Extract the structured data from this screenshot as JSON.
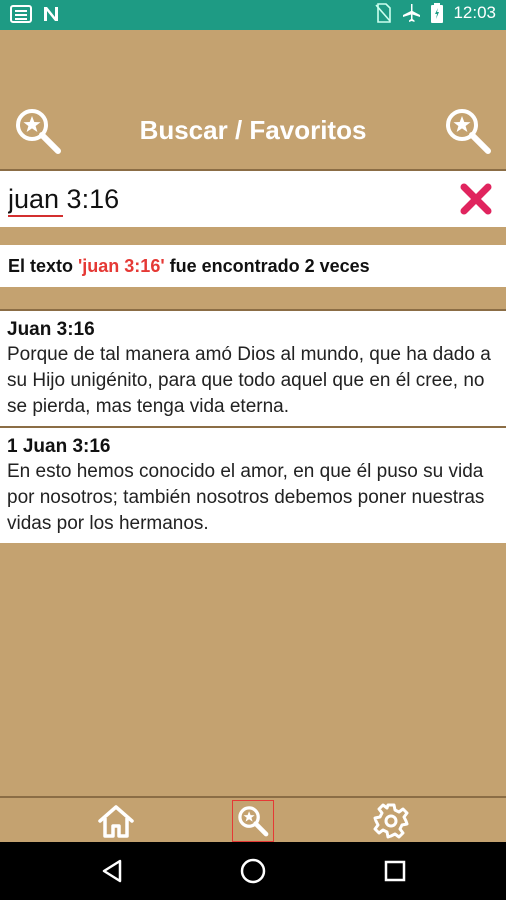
{
  "status_bar": {
    "time": "12:03"
  },
  "app_bar": {
    "title": "Buscar / Favoritos"
  },
  "search": {
    "value": "juan 3:16"
  },
  "result_banner": {
    "prefix": "El texto ",
    "query": "'juan 3:16'",
    "suffix": " fue encontrado 2 veces"
  },
  "results": [
    {
      "ref": "Juan 3:16",
      "text": "Porque de tal manera amó Dios al mundo, que ha dado a su Hijo unigénito, para que todo aquel que en él cree, no se pierda, mas tenga vida eterna."
    },
    {
      "ref": "1 Juan 3:16",
      "text": "En esto hemos conocido el amor, en que él puso su vida por nosotros; también nosotros debemos poner nuestras vidas por los hermanos."
    }
  ],
  "colors": {
    "background": "#c4a270",
    "status_bar": "#1e9b84",
    "accent_red": "#e53935",
    "divider": "#8b6d45"
  },
  "icons": {
    "app_bar_left": "search-star-icon",
    "app_bar_right": "search-star-icon",
    "clear": "close-icon",
    "nav_home": "home-icon",
    "nav_search": "search-star-icon",
    "nav_settings": "gear-icon"
  }
}
